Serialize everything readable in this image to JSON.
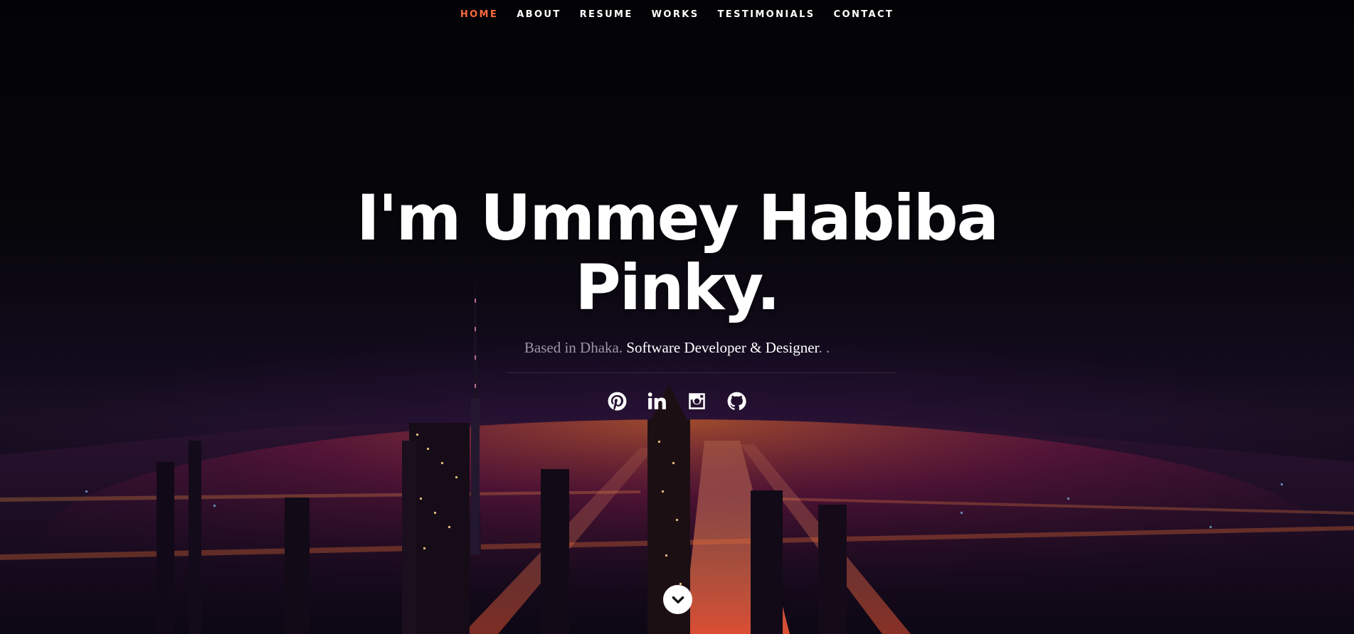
{
  "nav": {
    "items": [
      {
        "label": "HOME",
        "active": true
      },
      {
        "label": "ABOUT"
      },
      {
        "label": "RESUME"
      },
      {
        "label": "WORKS"
      },
      {
        "label": "TESTIMONIALS"
      },
      {
        "label": "CONTACT"
      }
    ],
    "active_color": "#ff6a3d"
  },
  "hero": {
    "title_line1": "I'm Ummey Habiba",
    "title_line2": "Pinky.",
    "subtitle_lead": "Based in Dhaka. ",
    "subtitle_highlight": "Software Developer & Designer",
    "subtitle_tail": ". ."
  },
  "social": [
    {
      "icon": "pinterest-icon"
    },
    {
      "icon": "linkedin-icon"
    },
    {
      "icon": "instagram-icon"
    },
    {
      "icon": "github-icon"
    }
  ],
  "scroll": {
    "icon": "chevron-down-icon"
  }
}
